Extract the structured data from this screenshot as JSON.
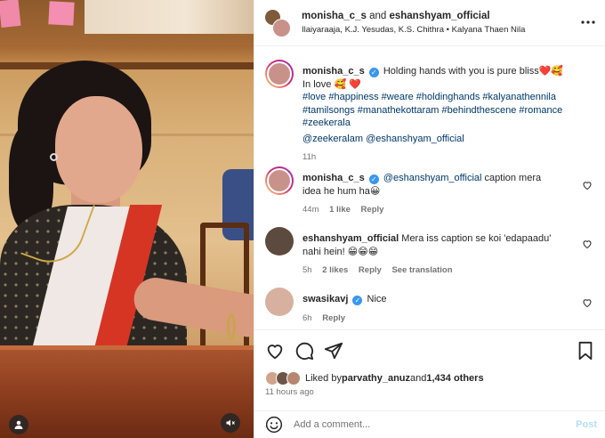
{
  "header": {
    "user1": "monisha_c_s",
    "and": " and ",
    "user2": "eshanshyam_official",
    "audio": "Ilaiyaraaja, K.J. Yesudas, K.S. Chithra • Kalyana Thaen Nila",
    "more_icon": "more-horizontal-icon"
  },
  "caption": {
    "username": "monisha_c_s",
    "text1": "Holding hands with you is pure bliss❤️🥰",
    "text2": "In love 🥰 ❤️",
    "hashtags": "#love #happiness #weare #holdinghands #kalyanathennila #tamilsongs #manathekottaram #behindthescene #romance #zeekerala",
    "mentions": "@zeekeralam @eshanshyam_official",
    "time": "11h"
  },
  "comments": [
    {
      "username": "monisha_c_s",
      "verified": true,
      "mention": "@eshanshyam_official",
      "text": " caption mera idea he hum ha😀",
      "time": "44m",
      "likes": "1 like",
      "reply": "Reply"
    },
    {
      "username": "eshanshyam_official",
      "verified": false,
      "text": "Mera iss caption se koi 'edapaadu' nahi hein! 😁😁😁",
      "time": "5h",
      "likes": "2 likes",
      "reply": "Reply",
      "translation": "See translation"
    },
    {
      "username": "swasikavj",
      "verified": true,
      "text": "Nice",
      "time": "6h",
      "reply": "Reply"
    }
  ],
  "likes": {
    "prefix": "Liked by ",
    "user": "parvathy_anuz",
    "middle": " and ",
    "others": "1,434 others",
    "time": "11 hours ago"
  },
  "add_comment": {
    "placeholder": "Add a comment...",
    "post_label": "Post"
  },
  "colors": {
    "verified": "#3897f0",
    "link": "#00376b",
    "post_button_disabled": "#b2dffc",
    "muted_text": "#737373"
  }
}
